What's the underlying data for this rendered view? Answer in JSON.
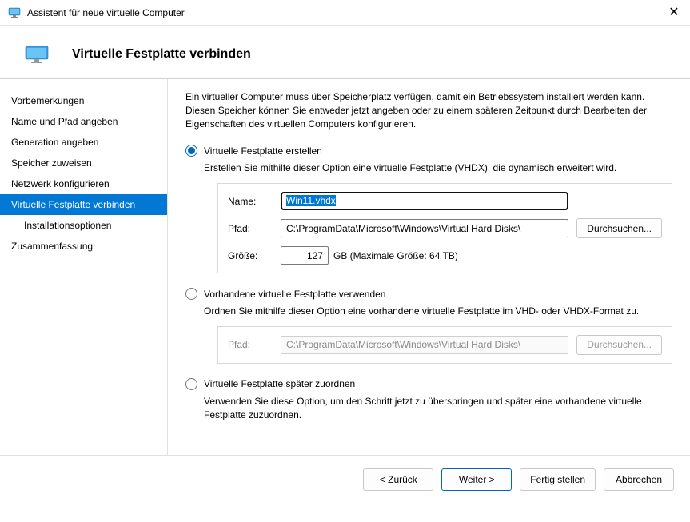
{
  "window": {
    "title": "Assistent für neue virtuelle Computer"
  },
  "header": {
    "title": "Virtuelle Festplatte verbinden"
  },
  "sidebar": {
    "items": [
      {
        "label": "Vorbemerkungen",
        "active": false,
        "indent": false
      },
      {
        "label": "Name und Pfad angeben",
        "active": false,
        "indent": false
      },
      {
        "label": "Generation angeben",
        "active": false,
        "indent": false
      },
      {
        "label": "Speicher zuweisen",
        "active": false,
        "indent": false
      },
      {
        "label": "Netzwerk konfigurieren",
        "active": false,
        "indent": false
      },
      {
        "label": "Virtuelle Festplatte verbinden",
        "active": true,
        "indent": false
      },
      {
        "label": "Installationsoptionen",
        "active": false,
        "indent": true
      },
      {
        "label": "Zusammenfassung",
        "active": false,
        "indent": false
      }
    ]
  },
  "content": {
    "intro": "Ein virtueller Computer muss über Speicherplatz verfügen, damit ein Betriebssystem installiert werden kann. Diesen Speicher können Sie entweder jetzt angeben oder zu einem späteren Zeitpunkt durch Bearbeiten der Eigenschaften des virtuellen Computers konfigurieren.",
    "option_create": {
      "label": "Virtuelle Festplatte erstellen",
      "desc": "Erstellen Sie mithilfe dieser Option eine virtuelle Festplatte (VHDX), die dynamisch erweitert wird.",
      "name_label": "Name:",
      "name_value": "Win11.vhdx",
      "path_label": "Pfad:",
      "path_value": "C:\\ProgramData\\Microsoft\\Windows\\Virtual Hard Disks\\",
      "browse": "Durchsuchen...",
      "size_label": "Größe:",
      "size_value": "127",
      "size_unit": "GB (Maximale Größe: 64 TB)"
    },
    "option_existing": {
      "label": "Vorhandene virtuelle Festplatte verwenden",
      "desc": "Ordnen Sie mithilfe dieser Option eine vorhandene virtuelle Festplatte im VHD- oder VHDX-Format zu.",
      "path_label": "Pfad:",
      "path_value": "C:\\ProgramData\\Microsoft\\Windows\\Virtual Hard Disks\\",
      "browse": "Durchsuchen..."
    },
    "option_later": {
      "label": "Virtuelle Festplatte später zuordnen",
      "desc": "Verwenden Sie diese Option, um den Schritt jetzt zu überspringen und später eine vorhandene virtuelle Festplatte zuzuordnen."
    }
  },
  "footer": {
    "back": "< Zurück",
    "next": "Weiter >",
    "finish": "Fertig stellen",
    "cancel": "Abbrechen"
  }
}
